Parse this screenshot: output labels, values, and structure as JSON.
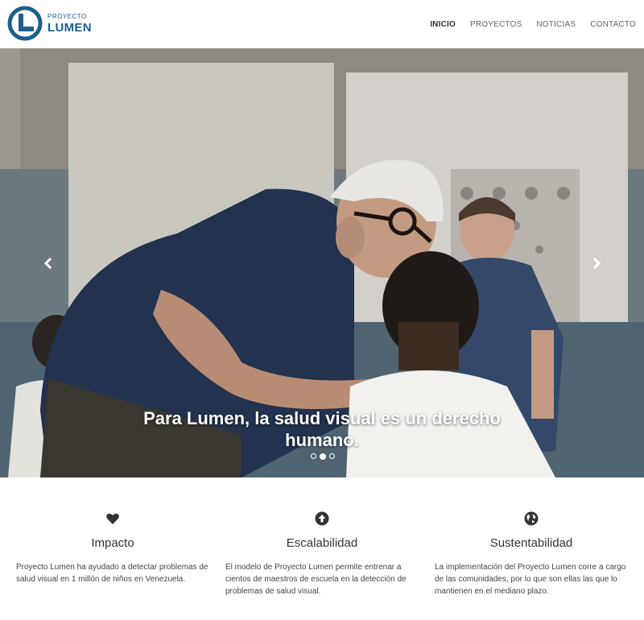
{
  "brand": {
    "sub": "PROYECTO",
    "main": "LUMEN",
    "color": "#1e5f8c"
  },
  "nav": {
    "items": [
      "INICIO",
      "PROYECTOS",
      "NOTICIAS",
      "CONTACTO"
    ],
    "active": "INICIO"
  },
  "hero": {
    "caption": "Para Lumen, la salud visual es un derecho humano.",
    "prev_icon": "chevron-left-icon",
    "next_icon": "chevron-right-icon",
    "slides": 3,
    "active_slide": 2
  },
  "features": [
    {
      "icon": "heart-icon",
      "title": "Impacto",
      "text": "Proyecto Lumen ha ayudado a detectar problemas de salud visual en 1 millón de niños en Venezuela."
    },
    {
      "icon": "arrow-up-circle-icon",
      "title": "Escalabilidad",
      "text": "El modelo de Proyecto Lumen permite entrenar a cientos de maestros de escuela en la detección de problemas de salud visual."
    },
    {
      "icon": "globe-icon",
      "title": "Sustentabilidad",
      "text": "La implementación del Proyecto Lumen corre a cargo de las comunidades, por lo que son ellas las que lo mantienen en el mediano plazo."
    }
  ]
}
